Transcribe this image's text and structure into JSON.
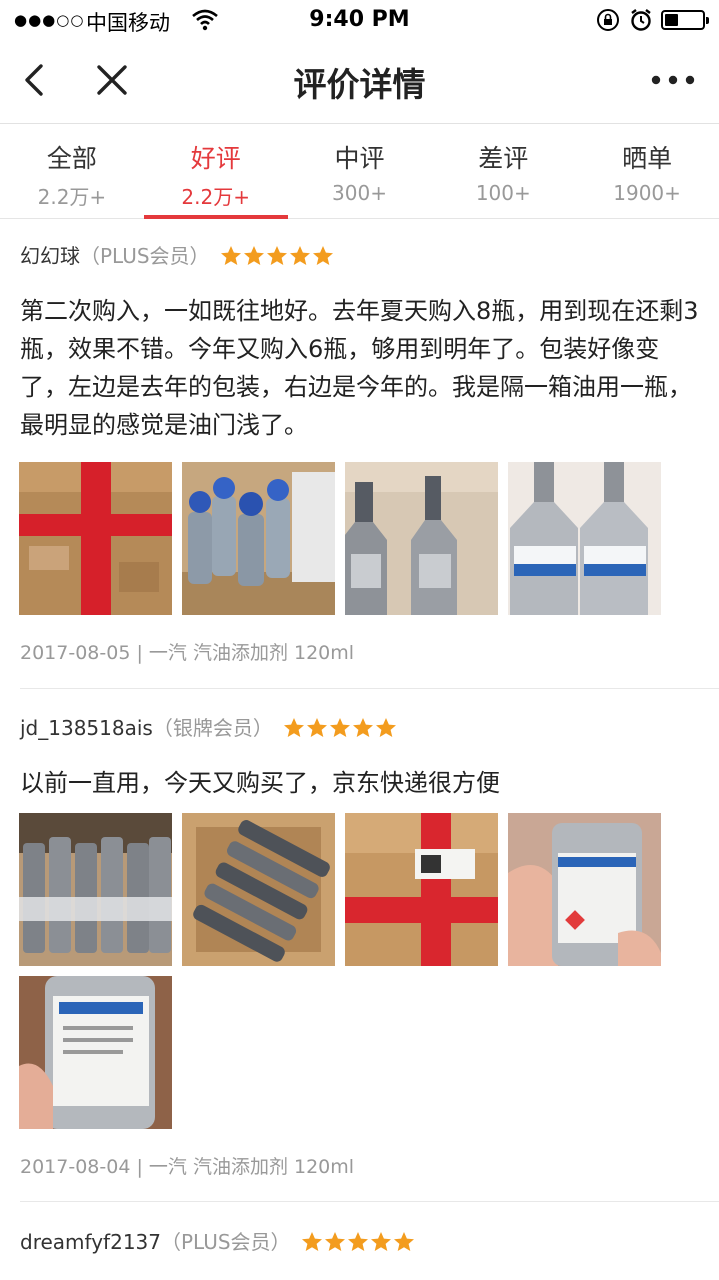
{
  "status_bar": {
    "signal": "●●●○○",
    "carrier": "中国移动",
    "time": "9:40 PM",
    "battery_level": 0.35
  },
  "nav": {
    "title": "评价详情"
  },
  "tabs": [
    {
      "label": "全部",
      "count": "2.2万+",
      "active": false
    },
    {
      "label": "好评",
      "count": "2.2万+",
      "active": true
    },
    {
      "label": "中评",
      "count": "300+",
      "active": false
    },
    {
      "label": "差评",
      "count": "100+",
      "active": false
    },
    {
      "label": "晒单",
      "count": "1900+",
      "active": false
    }
  ],
  "colors": {
    "accent": "#e4393c",
    "star": "#f39c1e",
    "muted_text": "#999999"
  },
  "reviews": [
    {
      "user": "幻幻球",
      "level": "（PLUS会员）",
      "stars": 5,
      "text": "第二次购入，一如既往地好。去年夏天购入8瓶，用到现在还剩3瓶，效果不错。今年又购入6瓶，够用到明年了。包装好像变了，左边是去年的包装，右边是今年的。我是隔一箱油用一瓶，最明显的感觉是油门浅了。",
      "photos": [
        "box-with-red-tape",
        "blue-cap-bottles-in-box",
        "silver-bottles-pair",
        "silver-bottles-labels"
      ],
      "date": "2017-08-05",
      "product": "一汽 汽油添加剂 120ml"
    },
    {
      "user": "jd_138518ais",
      "level": "（银牌会员）",
      "stars": 5,
      "text": "以前一直用，今天又购买了，京东快递很方便",
      "photos": [
        "bottles-row",
        "bottles-in-box",
        "jd-package",
        "bottle-in-hand",
        "bottle-closeup"
      ],
      "date": "2017-08-04",
      "product": "一汽 汽油添加剂 120ml"
    },
    {
      "user": "dreamfyf2137",
      "level": "（PLUS会员）",
      "stars": 5
    }
  ]
}
